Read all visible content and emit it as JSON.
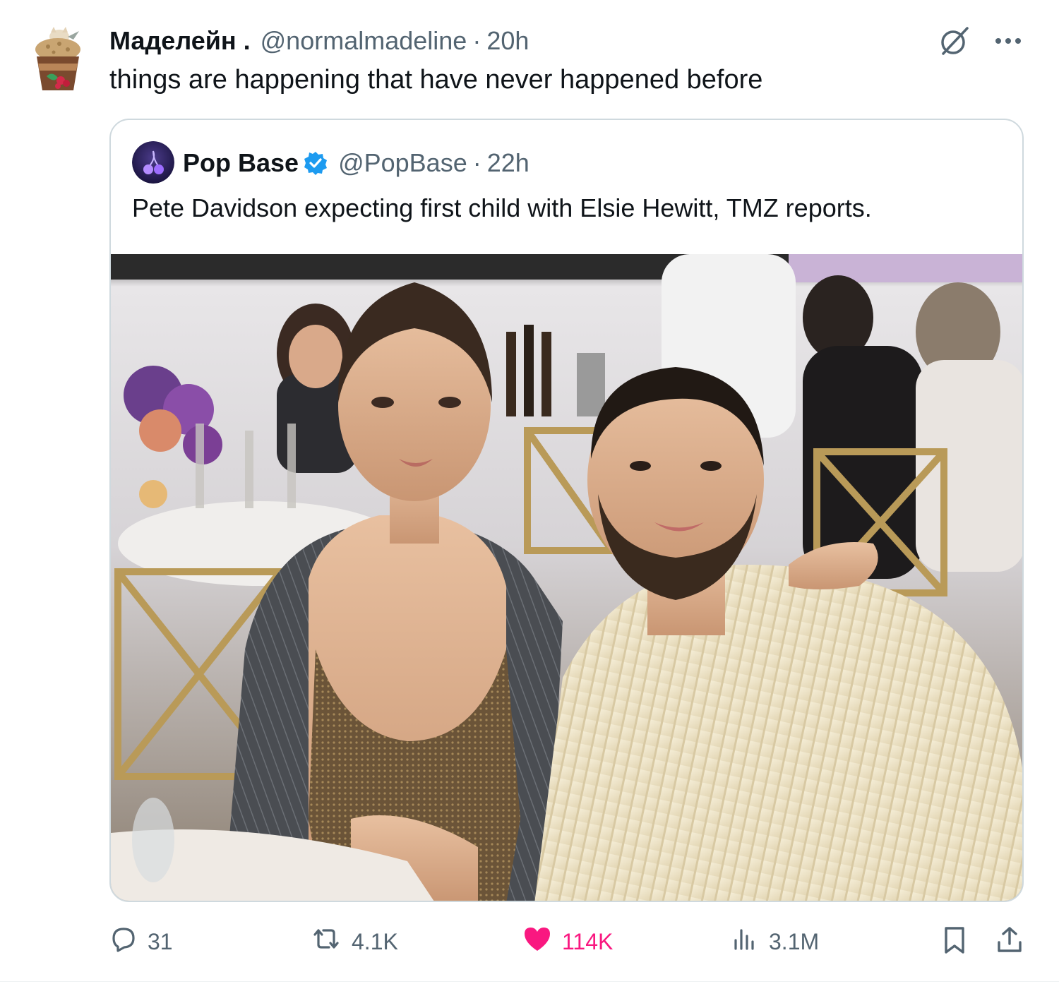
{
  "tweet": {
    "display_name": "Маделейн .",
    "handle": "@normalmadeline",
    "separator": "·",
    "time": "20h",
    "text": "things are happening that have never happened before",
    "avatar_icon": "cat-in-cup-avatar"
  },
  "top_actions": {
    "grok_icon": "grok-icon",
    "more_icon": "more-icon"
  },
  "quoted_tweet": {
    "display_name": "Pop Base",
    "verified": true,
    "verified_color": "#1d9bf0",
    "handle": "@PopBase",
    "separator": "·",
    "time": "22h",
    "text": "Pete Davidson expecting first child with Elsie Hewitt, TMZ reports.",
    "avatar_icon": "cherry-logo-avatar",
    "media": "photo-of-couple-at-dinner-event"
  },
  "engagement": {
    "replies": "31",
    "reposts": "4.1K",
    "likes": "114K",
    "liked": true,
    "like_color": "#f91880",
    "views": "3.1M"
  },
  "colors": {
    "text_primary": "#0f1419",
    "text_secondary": "#536471",
    "border": "#cfd9de"
  }
}
